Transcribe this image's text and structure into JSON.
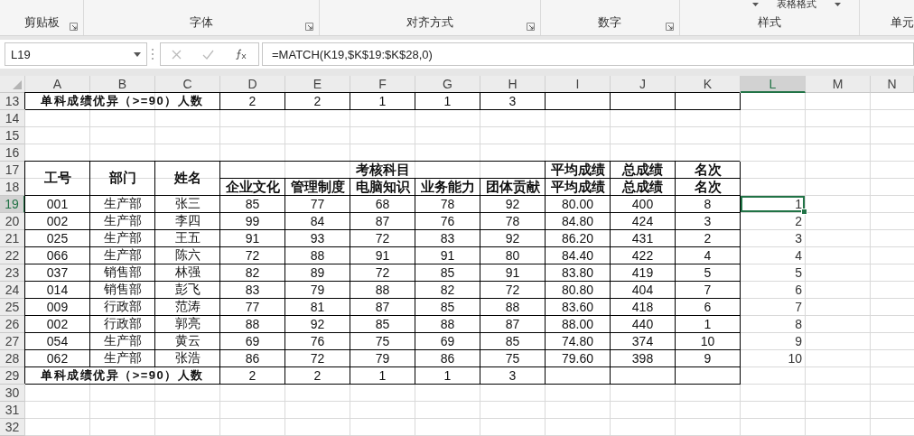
{
  "ribbon": {
    "groups": [
      {
        "label": "剪贴板",
        "launcher": true
      },
      {
        "label": "字体",
        "launcher": true
      },
      {
        "label": "对齐方式",
        "launcher": true
      },
      {
        "label": "数字",
        "launcher": true
      },
      {
        "label": "样式",
        "launcher": false,
        "button": "表格格式"
      },
      {
        "label": "单元",
        "launcher": false
      }
    ]
  },
  "formula_bar": {
    "name_box": "L19",
    "formula": "=MATCH(K19,$K$19:$K$28,0)"
  },
  "sheet": {
    "columns": [
      {
        "label": "A",
        "selected": false
      },
      {
        "label": "B",
        "selected": false
      },
      {
        "label": "C",
        "selected": false
      },
      {
        "label": "D",
        "selected": false
      },
      {
        "label": "E",
        "selected": false
      },
      {
        "label": "F",
        "selected": false
      },
      {
        "label": "G",
        "selected": false
      },
      {
        "label": "H",
        "selected": false
      },
      {
        "label": "I",
        "selected": false
      },
      {
        "label": "J",
        "selected": false
      },
      {
        "label": "K",
        "selected": false
      },
      {
        "label": "L",
        "selected": true
      },
      {
        "label": "M",
        "selected": false
      },
      {
        "label": "N",
        "selected": false
      }
    ],
    "rows": [
      {
        "number": "13",
        "selected": false,
        "cells": [
          {
            "kind": "label",
            "text": "单科成绩优异（>=90）人数",
            "selected": false
          },
          {
            "kind": "merge-left"
          },
          {
            "kind": "merge-left"
          },
          {
            "kind": "data",
            "text": "2",
            "selected": false
          },
          {
            "kind": "data",
            "text": "2",
            "selected": false
          },
          {
            "kind": "data",
            "text": "1",
            "selected": false
          },
          {
            "kind": "data",
            "text": "1",
            "selected": false
          },
          {
            "kind": "data",
            "text": "3",
            "selected": false
          },
          {
            "kind": "blank",
            "selected": false
          },
          {
            "kind": "blank",
            "selected": false
          },
          {
            "kind": "blank",
            "selected": false
          }
        ]
      },
      {
        "number": "14",
        "selected": false,
        "cells": []
      },
      {
        "number": "15",
        "selected": false,
        "cells": []
      },
      {
        "number": "16",
        "selected": false,
        "cells": []
      },
      {
        "number": "17",
        "selected": false,
        "cells": [
          {
            "kind": "header",
            "text": "工号",
            "selected": false
          },
          {
            "kind": "header",
            "text": "部门",
            "selected": false
          },
          {
            "kind": "header",
            "text": "姓名",
            "selected": false
          },
          {
            "kind": "merge-right"
          },
          {
            "kind": "merge-right"
          },
          {
            "kind": "header",
            "text": "考核科目",
            "selected": false
          },
          {
            "kind": "merge-left"
          },
          {
            "kind": "merge-left"
          },
          {
            "kind": "header",
            "text": "平均成绩",
            "selected": false
          },
          {
            "kind": "header",
            "text": "总成绩",
            "selected": false
          },
          {
            "kind": "header",
            "text": "名次",
            "selected": false
          }
        ]
      },
      {
        "number": "18",
        "selected": false,
        "cells": [
          {
            "kind": "merge-up"
          },
          {
            "kind": "merge-up"
          },
          {
            "kind": "merge-up"
          },
          {
            "kind": "header",
            "text": "企业文化",
            "selected": false
          },
          {
            "kind": "header",
            "text": "管理制度",
            "selected": false
          },
          {
            "kind": "header",
            "text": "电脑知识",
            "selected": false
          },
          {
            "kind": "header",
            "text": "业务能力",
            "selected": false
          },
          {
            "kind": "header",
            "text": "团体贡献",
            "selected": false
          },
          {
            "kind": "header",
            "text": "平均成绩",
            "selected": false
          },
          {
            "kind": "header",
            "text": "总成绩",
            "selected": false
          },
          {
            "kind": "header",
            "text": "名次",
            "selected": false
          }
        ]
      },
      {
        "number": "19",
        "selected": true,
        "cells": [
          {
            "kind": "data",
            "text": "001",
            "selected": false
          },
          {
            "kind": "data",
            "text": "生产部",
            "selected": false
          },
          {
            "kind": "data",
            "text": "张三",
            "selected": false
          },
          {
            "kind": "data",
            "text": "85",
            "selected": false
          },
          {
            "kind": "data",
            "text": "77",
            "selected": false
          },
          {
            "kind": "data",
            "text": "68",
            "selected": false
          },
          {
            "kind": "data",
            "text": "78",
            "selected": false
          },
          {
            "kind": "data",
            "text": "92",
            "selected": false
          },
          {
            "kind": "data",
            "text": "80.00",
            "selected": false
          },
          {
            "kind": "data",
            "text": "400",
            "selected": false
          },
          {
            "kind": "data",
            "text": "8",
            "selected": false
          },
          {
            "kind": "number",
            "text": "1",
            "selected": true
          }
        ]
      },
      {
        "number": "20",
        "selected": false,
        "cells": [
          {
            "kind": "data",
            "text": "002",
            "selected": false
          },
          {
            "kind": "data",
            "text": "生产部",
            "selected": false
          },
          {
            "kind": "data",
            "text": "李四",
            "selected": false
          },
          {
            "kind": "data",
            "text": "99",
            "selected": false
          },
          {
            "kind": "data",
            "text": "84",
            "selected": false
          },
          {
            "kind": "data",
            "text": "87",
            "selected": false
          },
          {
            "kind": "data",
            "text": "76",
            "selected": false
          },
          {
            "kind": "data",
            "text": "78",
            "selected": false
          },
          {
            "kind": "data",
            "text": "84.80",
            "selected": false
          },
          {
            "kind": "data",
            "text": "424",
            "selected": false
          },
          {
            "kind": "data",
            "text": "3",
            "selected": false
          },
          {
            "kind": "number",
            "text": "2",
            "selected": false
          }
        ]
      },
      {
        "number": "21",
        "selected": false,
        "cells": [
          {
            "kind": "data",
            "text": "025",
            "selected": false
          },
          {
            "kind": "data",
            "text": "生产部",
            "selected": false
          },
          {
            "kind": "data",
            "text": "王五",
            "selected": false
          },
          {
            "kind": "data",
            "text": "91",
            "selected": false
          },
          {
            "kind": "data",
            "text": "93",
            "selected": false
          },
          {
            "kind": "data",
            "text": "72",
            "selected": false
          },
          {
            "kind": "data",
            "text": "83",
            "selected": false
          },
          {
            "kind": "data",
            "text": "92",
            "selected": false
          },
          {
            "kind": "data",
            "text": "86.20",
            "selected": false
          },
          {
            "kind": "data",
            "text": "431",
            "selected": false
          },
          {
            "kind": "data",
            "text": "2",
            "selected": false
          },
          {
            "kind": "number",
            "text": "3",
            "selected": false
          }
        ]
      },
      {
        "number": "22",
        "selected": false,
        "cells": [
          {
            "kind": "data",
            "text": "066",
            "selected": false
          },
          {
            "kind": "data",
            "text": "生产部",
            "selected": false
          },
          {
            "kind": "data",
            "text": "陈六",
            "selected": false
          },
          {
            "kind": "data",
            "text": "72",
            "selected": false
          },
          {
            "kind": "data",
            "text": "88",
            "selected": false
          },
          {
            "kind": "data",
            "text": "91",
            "selected": false
          },
          {
            "kind": "data",
            "text": "91",
            "selected": false
          },
          {
            "kind": "data",
            "text": "80",
            "selected": false
          },
          {
            "kind": "data",
            "text": "84.40",
            "selected": false
          },
          {
            "kind": "data",
            "text": "422",
            "selected": false
          },
          {
            "kind": "data",
            "text": "4",
            "selected": false
          },
          {
            "kind": "number",
            "text": "4",
            "selected": false
          }
        ]
      },
      {
        "number": "23",
        "selected": false,
        "cells": [
          {
            "kind": "data",
            "text": "037",
            "selected": false
          },
          {
            "kind": "data",
            "text": "销售部",
            "selected": false
          },
          {
            "kind": "data",
            "text": "林强",
            "selected": false
          },
          {
            "kind": "data",
            "text": "82",
            "selected": false
          },
          {
            "kind": "data",
            "text": "89",
            "selected": false
          },
          {
            "kind": "data",
            "text": "72",
            "selected": false
          },
          {
            "kind": "data",
            "text": "85",
            "selected": false
          },
          {
            "kind": "data",
            "text": "91",
            "selected": false
          },
          {
            "kind": "data",
            "text": "83.80",
            "selected": false
          },
          {
            "kind": "data",
            "text": "419",
            "selected": false
          },
          {
            "kind": "data",
            "text": "5",
            "selected": false
          },
          {
            "kind": "number",
            "text": "5",
            "selected": false
          }
        ]
      },
      {
        "number": "24",
        "selected": false,
        "cells": [
          {
            "kind": "data",
            "text": "014",
            "selected": false
          },
          {
            "kind": "data",
            "text": "销售部",
            "selected": false
          },
          {
            "kind": "data",
            "text": "彭飞",
            "selected": false
          },
          {
            "kind": "data",
            "text": "83",
            "selected": false
          },
          {
            "kind": "data",
            "text": "79",
            "selected": false
          },
          {
            "kind": "data",
            "text": "88",
            "selected": false
          },
          {
            "kind": "data",
            "text": "82",
            "selected": false
          },
          {
            "kind": "data",
            "text": "72",
            "selected": false
          },
          {
            "kind": "data",
            "text": "80.80",
            "selected": false
          },
          {
            "kind": "data",
            "text": "404",
            "selected": false
          },
          {
            "kind": "data",
            "text": "7",
            "selected": false
          },
          {
            "kind": "number",
            "text": "6",
            "selected": false
          }
        ]
      },
      {
        "number": "25",
        "selected": false,
        "cells": [
          {
            "kind": "data",
            "text": "009",
            "selected": false
          },
          {
            "kind": "data",
            "text": "行政部",
            "selected": false
          },
          {
            "kind": "data",
            "text": "范涛",
            "selected": false
          },
          {
            "kind": "data",
            "text": "77",
            "selected": false
          },
          {
            "kind": "data",
            "text": "81",
            "selected": false
          },
          {
            "kind": "data",
            "text": "87",
            "selected": false
          },
          {
            "kind": "data",
            "text": "85",
            "selected": false
          },
          {
            "kind": "data",
            "text": "88",
            "selected": false
          },
          {
            "kind": "data",
            "text": "83.60",
            "selected": false
          },
          {
            "kind": "data",
            "text": "418",
            "selected": false
          },
          {
            "kind": "data",
            "text": "6",
            "selected": false
          },
          {
            "kind": "number",
            "text": "7",
            "selected": false
          }
        ]
      },
      {
        "number": "26",
        "selected": false,
        "cells": [
          {
            "kind": "data",
            "text": "002",
            "selected": false
          },
          {
            "kind": "data",
            "text": "行政部",
            "selected": false
          },
          {
            "kind": "data",
            "text": "郭亮",
            "selected": false
          },
          {
            "kind": "data",
            "text": "88",
            "selected": false
          },
          {
            "kind": "data",
            "text": "92",
            "selected": false
          },
          {
            "kind": "data",
            "text": "85",
            "selected": false
          },
          {
            "kind": "data",
            "text": "88",
            "selected": false
          },
          {
            "kind": "data",
            "text": "87",
            "selected": false
          },
          {
            "kind": "data",
            "text": "88.00",
            "selected": false
          },
          {
            "kind": "data",
            "text": "440",
            "selected": false
          },
          {
            "kind": "data",
            "text": "1",
            "selected": false
          },
          {
            "kind": "number",
            "text": "8",
            "selected": false
          }
        ]
      },
      {
        "number": "27",
        "selected": false,
        "cells": [
          {
            "kind": "data",
            "text": "054",
            "selected": false
          },
          {
            "kind": "data",
            "text": "生产部",
            "selected": false
          },
          {
            "kind": "data",
            "text": "黄云",
            "selected": false
          },
          {
            "kind": "data",
            "text": "69",
            "selected": false
          },
          {
            "kind": "data",
            "text": "76",
            "selected": false
          },
          {
            "kind": "data",
            "text": "75",
            "selected": false
          },
          {
            "kind": "data",
            "text": "69",
            "selected": false
          },
          {
            "kind": "data",
            "text": "85",
            "selected": false
          },
          {
            "kind": "data",
            "text": "74.80",
            "selected": false
          },
          {
            "kind": "data",
            "text": "374",
            "selected": false
          },
          {
            "kind": "data",
            "text": "10",
            "selected": false
          },
          {
            "kind": "number",
            "text": "9",
            "selected": false
          }
        ]
      },
      {
        "number": "28",
        "selected": false,
        "cells": [
          {
            "kind": "data",
            "text": "062",
            "selected": false
          },
          {
            "kind": "data",
            "text": "生产部",
            "selected": false
          },
          {
            "kind": "data",
            "text": "张浩",
            "selected": false
          },
          {
            "kind": "data",
            "text": "86",
            "selected": false
          },
          {
            "kind": "data",
            "text": "72",
            "selected": false
          },
          {
            "kind": "data",
            "text": "79",
            "selected": false
          },
          {
            "kind": "data",
            "text": "86",
            "selected": false
          },
          {
            "kind": "data",
            "text": "75",
            "selected": false
          },
          {
            "kind": "data",
            "text": "79.60",
            "selected": false
          },
          {
            "kind": "data",
            "text": "398",
            "selected": false
          },
          {
            "kind": "data",
            "text": "9",
            "selected": false
          },
          {
            "kind": "number",
            "text": "10",
            "selected": false
          }
        ]
      },
      {
        "number": "29",
        "selected": false,
        "cells": [
          {
            "kind": "label",
            "text": "单科成绩优异（>=90）人数",
            "selected": false
          },
          {
            "kind": "merge-left"
          },
          {
            "kind": "merge-left"
          },
          {
            "kind": "data",
            "text": "2",
            "selected": false
          },
          {
            "kind": "data",
            "text": "2",
            "selected": false
          },
          {
            "kind": "data",
            "text": "1",
            "selected": false
          },
          {
            "kind": "data",
            "text": "1",
            "selected": false
          },
          {
            "kind": "data",
            "text": "3",
            "selected": false
          },
          {
            "kind": "blank",
            "selected": false
          },
          {
            "kind": "blank",
            "selected": false
          },
          {
            "kind": "blank",
            "selected": false
          }
        ]
      },
      {
        "number": "30",
        "selected": false,
        "cells": []
      },
      {
        "number": "31",
        "selected": false,
        "cells": []
      },
      {
        "number": "32",
        "selected": false,
        "cells": []
      }
    ]
  }
}
